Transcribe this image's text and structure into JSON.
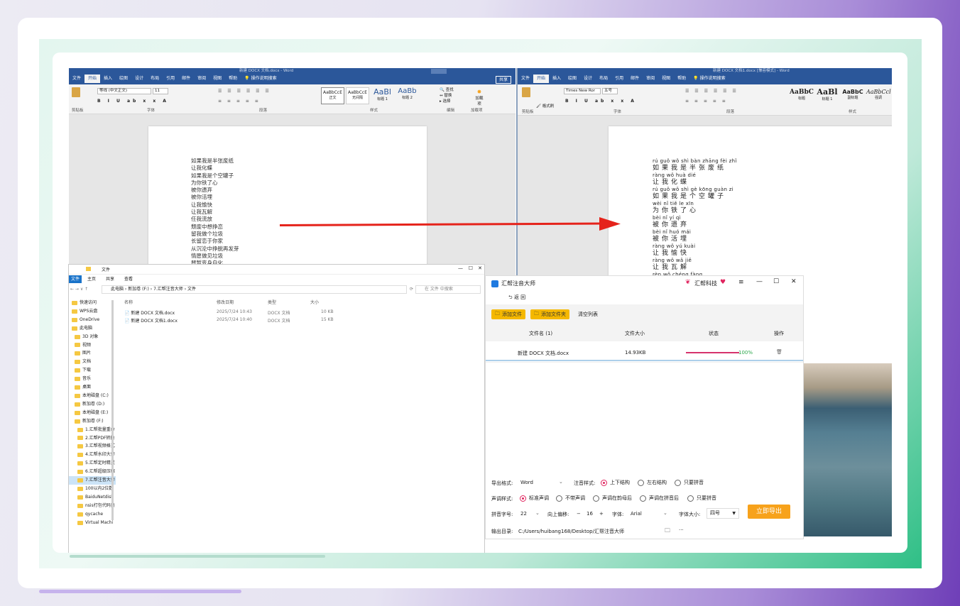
{
  "left_word": {
    "title": "新建 DOCX 文档.docx - Word",
    "share": "共享",
    "tabs": [
      "文件",
      "开始",
      "插入",
      "绘图",
      "设计",
      "布局",
      "引用",
      "邮件",
      "审阅",
      "视图",
      "帮助",
      "操作说明搜索"
    ],
    "font_name": "等线 (中文正文)",
    "font_size": "11",
    "styles": [
      "AaBbCcE",
      "AaBbCcE",
      "AaBl",
      "AaBb"
    ],
    "style_names": [
      "正文",
      "无间隔",
      "标题 1",
      "标题 2"
    ],
    "groups": [
      "剪贴板",
      "字体",
      "段落",
      "样式",
      "编辑",
      "加载项"
    ],
    "edit_items": [
      "查找",
      "替换",
      "选择"
    ],
    "addin_label": "加载项",
    "lines": [
      "如果我是半张废纸",
      "让我化蝶",
      "如果我是个空罐子",
      "为你铁了心",
      "被你遗弃",
      "被你活埋",
      "让我愉快",
      "让我瓦解",
      "任我流放",
      "颓废中想挣恋",
      "留我做个垃圾",
      "长留恋于你家",
      "从沉沦中挣脱再发芽",
      "情愿做见垃圾",
      "替暂变身自化"
    ]
  },
  "right_word": {
    "title": "新建 DOCX 文档1.docx [兼容模式] - Word",
    "tabs": [
      "文件",
      "开始",
      "插入",
      "绘图",
      "设计",
      "布局",
      "引用",
      "邮件",
      "审阅",
      "视图",
      "帮助",
      "操作说明搜索"
    ],
    "font_name": "Times New Ror",
    "font_size": "五号",
    "styles": [
      "AaBbC",
      "AaBl",
      "AaBbC",
      "AaBbCcl"
    ],
    "style_names": [
      "标题",
      "标题 1",
      "副标题",
      "强调"
    ],
    "groups": [
      "剪贴板",
      "字体",
      "段落",
      "样式"
    ],
    "format_painter": "格式刷",
    "pinyin_pairs": [
      {
        "py": "rú guǒ wǒ shì bàn zhāng fèi zhǐ",
        "hz": "如果我是半张废纸"
      },
      {
        "py": "ràng wǒ huà dié",
        "hz": "让我化蝶"
      },
      {
        "py": "rú guǒ wǒ shì gè kōng guàn zi",
        "hz": "如果我是个空罐子"
      },
      {
        "py": "wèi nǐ tiě le xīn",
        "hz": "为你铁了心"
      },
      {
        "py": "bèi nǐ yí qì",
        "hz": "被你遗弃"
      },
      {
        "py": "bèi nǐ huó mái",
        "hz": "被你活埋"
      },
      {
        "py": "ràng wǒ yú kuài",
        "hz": "让我愉快"
      },
      {
        "py": "ràng wǒ wǎ jiě",
        "hz": "让我瓦解"
      },
      {
        "py": "rèn wǒ chéng fàng",
        "hz": ""
      }
    ]
  },
  "explorer": {
    "title": "文件",
    "tabs": [
      "文件",
      "主页",
      "共享",
      "查看"
    ],
    "breadcrumb": [
      "此电脑",
      "新加卷 (F:)",
      "7.汇帮注音大师",
      "文件"
    ],
    "search_placeholder": "在 文件 中搜索",
    "columns": [
      "名称",
      "修改日期",
      "类型",
      "大小"
    ],
    "files": [
      {
        "name": "新建 DOCX 文档.docx",
        "date": "2025/7/24 10:43",
        "type": "DOCX 文档",
        "size": "10 KB"
      },
      {
        "name": "新建 DOCX 文档1.docx",
        "date": "2025/7/24 10:40",
        "type": "DOCX 文档",
        "size": "15 KB"
      }
    ],
    "nav": [
      "快速访问",
      "WPS云盘",
      "OneDrive",
      "此电脑",
      "3D 对象",
      "视频",
      "图片",
      "文档",
      "下载",
      "音乐",
      "桌面",
      "本地磁盘 (C:)",
      "新加卷 (D:)",
      "本地磁盘 (E:)",
      "新加卷 (F:)",
      "1.汇帮批量重命",
      "2.汇帮PDF转换",
      "3.汇帮视频格式",
      "4.汇帮水印大师",
      "5.汇帮定时精灵",
      "6.汇帮超级压缩",
      "7.汇帮注音大师",
      "100以内2位数",
      "BaiduNetdisk",
      "nsis打包代码集",
      "qycache",
      "Virtual Machi"
    ]
  },
  "app": {
    "title": "汇帮注音大师",
    "brand": "汇帮科技",
    "back": "返 回",
    "add_file": "添加文件",
    "add_folder": "添加文件夹",
    "clear": "清空列表",
    "columns": [
      "文件名 (1)",
      "文件大小",
      "状态",
      "操作"
    ],
    "row": {
      "name": "新建 DOCX 文档.docx",
      "size": "14.93KB",
      "progress": 1.0,
      "progress_text": "100%"
    },
    "export_format_label": "导出格式:",
    "export_format": "Word",
    "pinyin_style_label": "注音样式:",
    "pinyin_styles": [
      "上下结构",
      "左右结构",
      "只要拼音"
    ],
    "tone_style_label": "声调样式:",
    "tone_styles": [
      "标准声调",
      "不带声调",
      "声调在韵母后",
      "声调在拼音后",
      "只要拼音"
    ],
    "pinyin_size_label": "拼音字号:",
    "pinyin_size": "22",
    "offset_label": "向上偏移:",
    "offset": "16",
    "font_label": "字体:",
    "font": "Arial",
    "char_size_label": "字体大小:",
    "char_size": "四号",
    "export_btn": "立即导出",
    "output_label": "输出目录:",
    "output_path": "C:/Users/huibang168/Desktop/汇帮注音大师",
    "more": "···"
  },
  "colors": {
    "word_blue": "#2b579a",
    "accent_yellow": "#f5b800",
    "export_orange": "#f7a21b",
    "progress": "#d6336c",
    "arrow": "#e5231b"
  }
}
